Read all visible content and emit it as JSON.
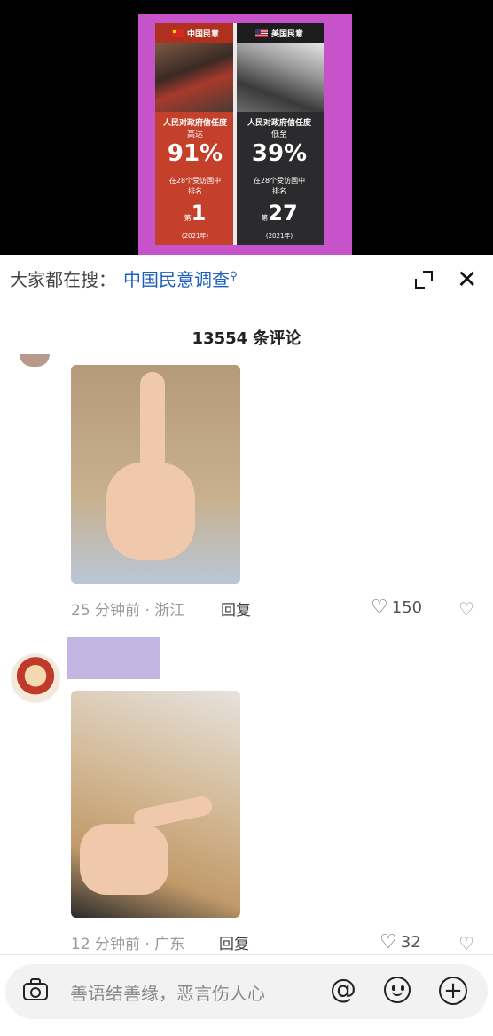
{
  "video": {
    "left": {
      "title": "中国民意",
      "line1": "人民对政府信任度",
      "line2": "高达",
      "percent": "91%",
      "line3": "在28个受访国中",
      "line4": "排名",
      "rank_prefix": "第",
      "rank": "1",
      "year": "(2021年)"
    },
    "right": {
      "title": "美国民意",
      "line1": "人民对政府信任度",
      "line2": "低至",
      "percent": "39%",
      "line3": "在28个受访国中",
      "line4": "排名",
      "rank_prefix": "第",
      "rank": "27",
      "year": "(2021年)"
    }
  },
  "search": {
    "prefix": "大家都在搜：",
    "keyword": "中国民意调查"
  },
  "comments_count": "13554 条评论",
  "comments": [
    {
      "meta": "25 分钟前 · 浙江",
      "reply": "回复",
      "likes": "150"
    },
    {
      "meta": "12 分钟前 · 广东",
      "reply": "回复",
      "likes": "32"
    }
  ],
  "input": {
    "placeholder": "善语结善缘，恶言伤人心"
  },
  "icons": {
    "at": "@",
    "close": "✕",
    "plus": "+",
    "heart": "♡"
  }
}
